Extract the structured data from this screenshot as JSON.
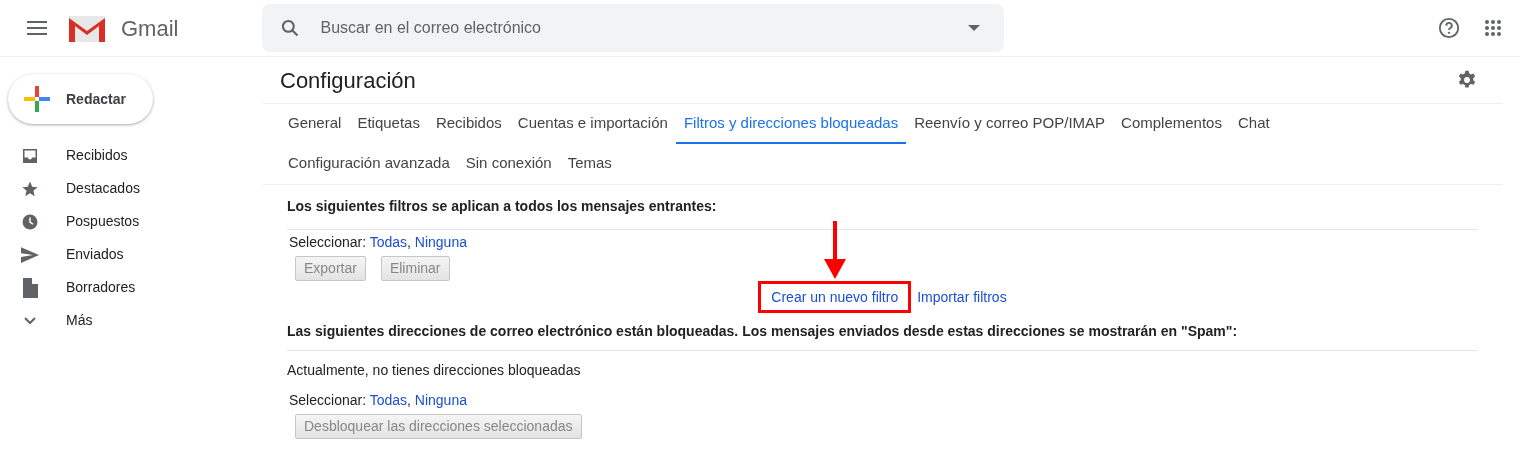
{
  "header": {
    "app_name": "Gmail",
    "search": {
      "placeholder": "Buscar en el correo electrónico"
    }
  },
  "sidebar": {
    "compose": "Redactar",
    "items": [
      {
        "label": "Recibidos"
      },
      {
        "label": "Destacados"
      },
      {
        "label": "Pospuestos"
      },
      {
        "label": "Enviados"
      },
      {
        "label": "Borradores"
      },
      {
        "label": "Más"
      }
    ]
  },
  "page_title": "Configuración",
  "tab_rows": [
    [
      {
        "label": "General",
        "selected": false
      },
      {
        "label": "Etiquetas",
        "selected": false
      },
      {
        "label": "Recibidos",
        "selected": false
      },
      {
        "label": "Cuentas e importación",
        "selected": false
      },
      {
        "label": "Filtros y direcciones bloqueadas",
        "selected": true
      },
      {
        "label": "Reenvío y correo POP/IMAP",
        "selected": false
      },
      {
        "label": "Complementos",
        "selected": false
      },
      {
        "label": "Chat",
        "selected": false
      }
    ],
    [
      {
        "label": "Configuración avanzada",
        "selected": false
      },
      {
        "label": "Sin conexión",
        "selected": false
      },
      {
        "label": "Temas",
        "selected": false
      }
    ]
  ],
  "filters": {
    "heading": "Los siguientes filtros se aplican a todos los mensajes entrantes:",
    "select": {
      "label": "Seleccionar:",
      "options": [
        "Todas",
        "Ninguna"
      ],
      "separator": ","
    },
    "buttons": [
      {
        "label": "Exportar",
        "disabled": true
      },
      {
        "label": "Eliminar",
        "disabled": true
      }
    ],
    "links": [
      {
        "label": "Crear un nuevo filtro",
        "highlighted": true
      },
      {
        "label": "Importar filtros",
        "highlighted": false
      }
    ]
  },
  "blocked": {
    "heading": "Las siguientes direcciones de correo electrónico están bloqueadas. Los mensajes enviados desde estas direcciones se mostrarán en \"Spam\":",
    "empty_message": "Actualmente, no tienes direcciones bloqueadas",
    "select": {
      "label": "Seleccionar:",
      "options": [
        "Todas",
        "Ninguna"
      ],
      "separator": ","
    },
    "buttons": [
      {
        "label": "Desbloquear las direcciones seleccionadas",
        "disabled": true
      }
    ]
  }
}
